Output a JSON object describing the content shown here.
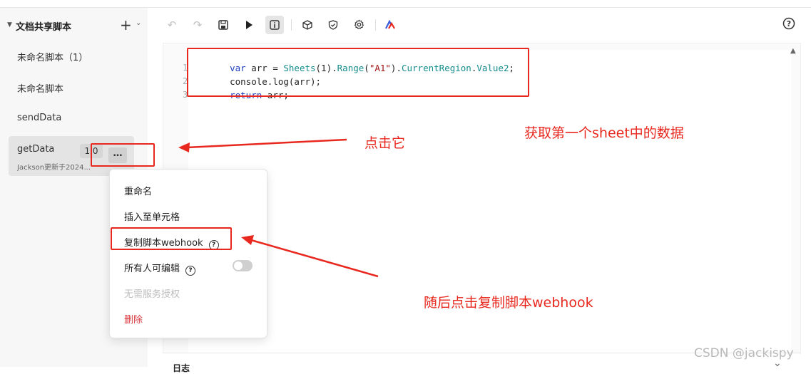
{
  "sidebar": {
    "title": "文档共享脚本",
    "items": [
      {
        "label": "未命名脚本（1）"
      },
      {
        "label": "未命名脚本"
      },
      {
        "label": "sendData"
      },
      {
        "label": "getData",
        "version": "1.0",
        "subtitle": "Jackson更新于2024..."
      }
    ]
  },
  "toolbar": {
    "icons": [
      "undo-icon",
      "redo-icon",
      "save-icon",
      "run-icon",
      "info-icon",
      "box-icon",
      "shield-icon",
      "gear-icon",
      "brand-icon",
      "help-icon"
    ]
  },
  "editor": {
    "line_numbers": [
      "1",
      "2",
      "3"
    ],
    "lines": [
      {
        "t1": "var",
        "t2": " arr = ",
        "t3": "Sheets",
        "t4": "(1).",
        "t5": "Range",
        "t6": "(",
        "t7": "\"A1\"",
        "t8": ").",
        "t9": "CurrentRegion",
        "t10": ".",
        "t11": "Value2",
        "t12": ";"
      },
      {
        "text": "console.log(arr);"
      },
      {
        "t1": "return",
        "t2": " arr;"
      }
    ]
  },
  "bottom_panel": {
    "label": "日志"
  },
  "context_menu": {
    "items": [
      {
        "label": "重命名"
      },
      {
        "label": "插入至单元格"
      },
      {
        "label": "复制脚本webhook"
      },
      {
        "label": "所有人可编辑"
      },
      {
        "label": "无需服务授权"
      },
      {
        "label": "删除"
      }
    ],
    "toggle_on": false
  },
  "annotations": {
    "click_it": "点击它",
    "get_data": "获取第一个sheet中的数据",
    "then_copy": "随后点击复制脚本webhook"
  },
  "watermark": "CSDN @jackispy",
  "colors": {
    "annotation": "#e8281e",
    "danger": "#d9363e",
    "keyword": "#1f3fbf",
    "function": "#148c8c"
  }
}
